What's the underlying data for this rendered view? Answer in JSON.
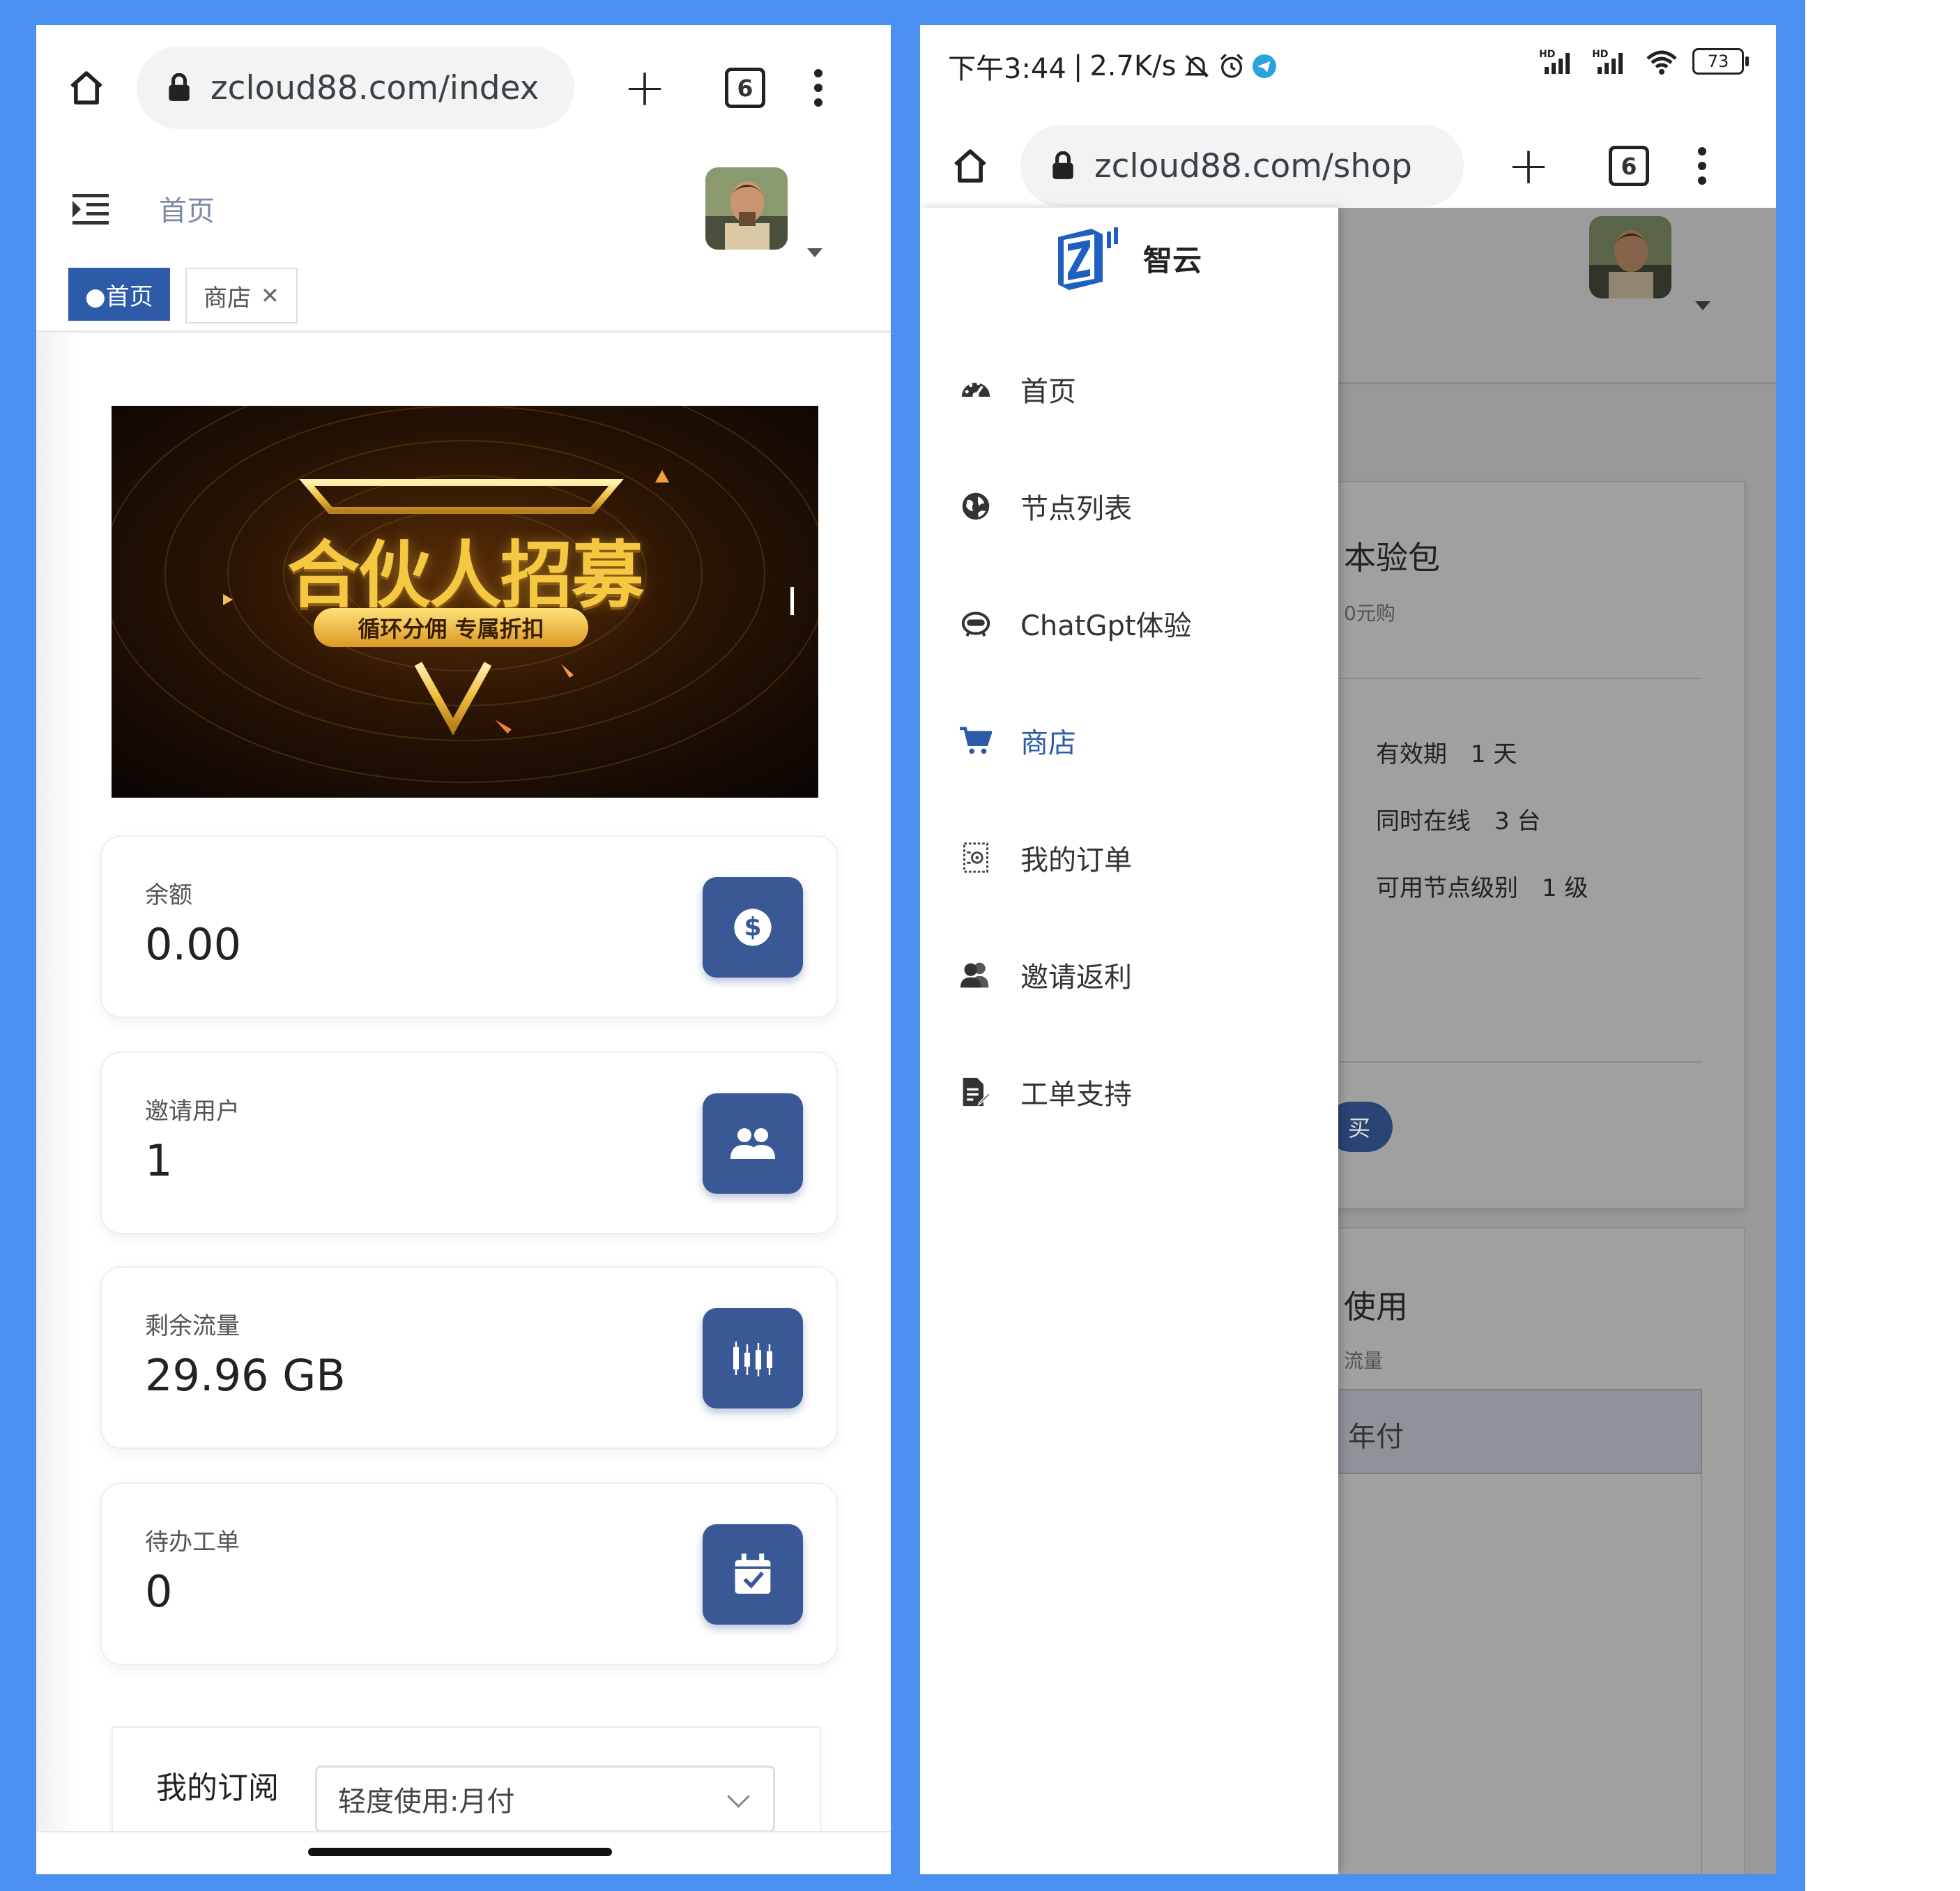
{
  "left": {
    "browser": {
      "url": "zcloud88.com/index",
      "tab_count": "6"
    },
    "header": {
      "title": "首页"
    },
    "tags": [
      {
        "label": "●首页",
        "active": true
      },
      {
        "label": "商店",
        "active": false
      }
    ],
    "banner": {
      "title": "合伙人招募",
      "subtitle": "循环分佣 专属折扣"
    },
    "stats": [
      {
        "label": "余额",
        "value": "0.00",
        "icon": "dollar-icon"
      },
      {
        "label": "邀请用户",
        "value": "1",
        "icon": "users-icon"
      },
      {
        "label": "剩余流量",
        "value": "29.96 GB",
        "icon": "chart-icon"
      },
      {
        "label": "待办工单",
        "value": "0",
        "icon": "calendar-check-icon"
      }
    ],
    "subscription": {
      "label": "我的订阅",
      "selected": "轻度使用:月付"
    }
  },
  "right": {
    "status": {
      "time": "下午3:44",
      "speed": "2.7K/s",
      "battery": "73"
    },
    "browser": {
      "url": "zcloud88.com/shop",
      "tab_count": "6"
    },
    "brand": {
      "name": "智云"
    },
    "menu": [
      {
        "label": "首页",
        "icon": "dashboard-icon",
        "active": false
      },
      {
        "label": "节点列表",
        "icon": "globe-icon",
        "active": false
      },
      {
        "label": "ChatGpt体验",
        "icon": "robot-icon",
        "active": false
      },
      {
        "label": "商店",
        "icon": "cart-icon",
        "active": true
      },
      {
        "label": "我的订单",
        "icon": "order-icon",
        "active": false
      },
      {
        "label": "邀请返利",
        "icon": "user-group-icon",
        "active": false
      },
      {
        "label": "工单支持",
        "icon": "ticket-icon",
        "active": false
      }
    ],
    "behind": {
      "card1_title": "本验包",
      "card1_sub": "0元购",
      "rows": [
        "有效期　1 天",
        "同时在线　3 台",
        "可用节点级别　1 级"
      ],
      "buy_label": "买",
      "card2_title": "使用",
      "card2_sub": "流量",
      "card2_select": "年付"
    }
  },
  "colors": {
    "frame": "#4a90f0",
    "primary": "#3a5896",
    "active_tag": "#2e5ba8"
  }
}
